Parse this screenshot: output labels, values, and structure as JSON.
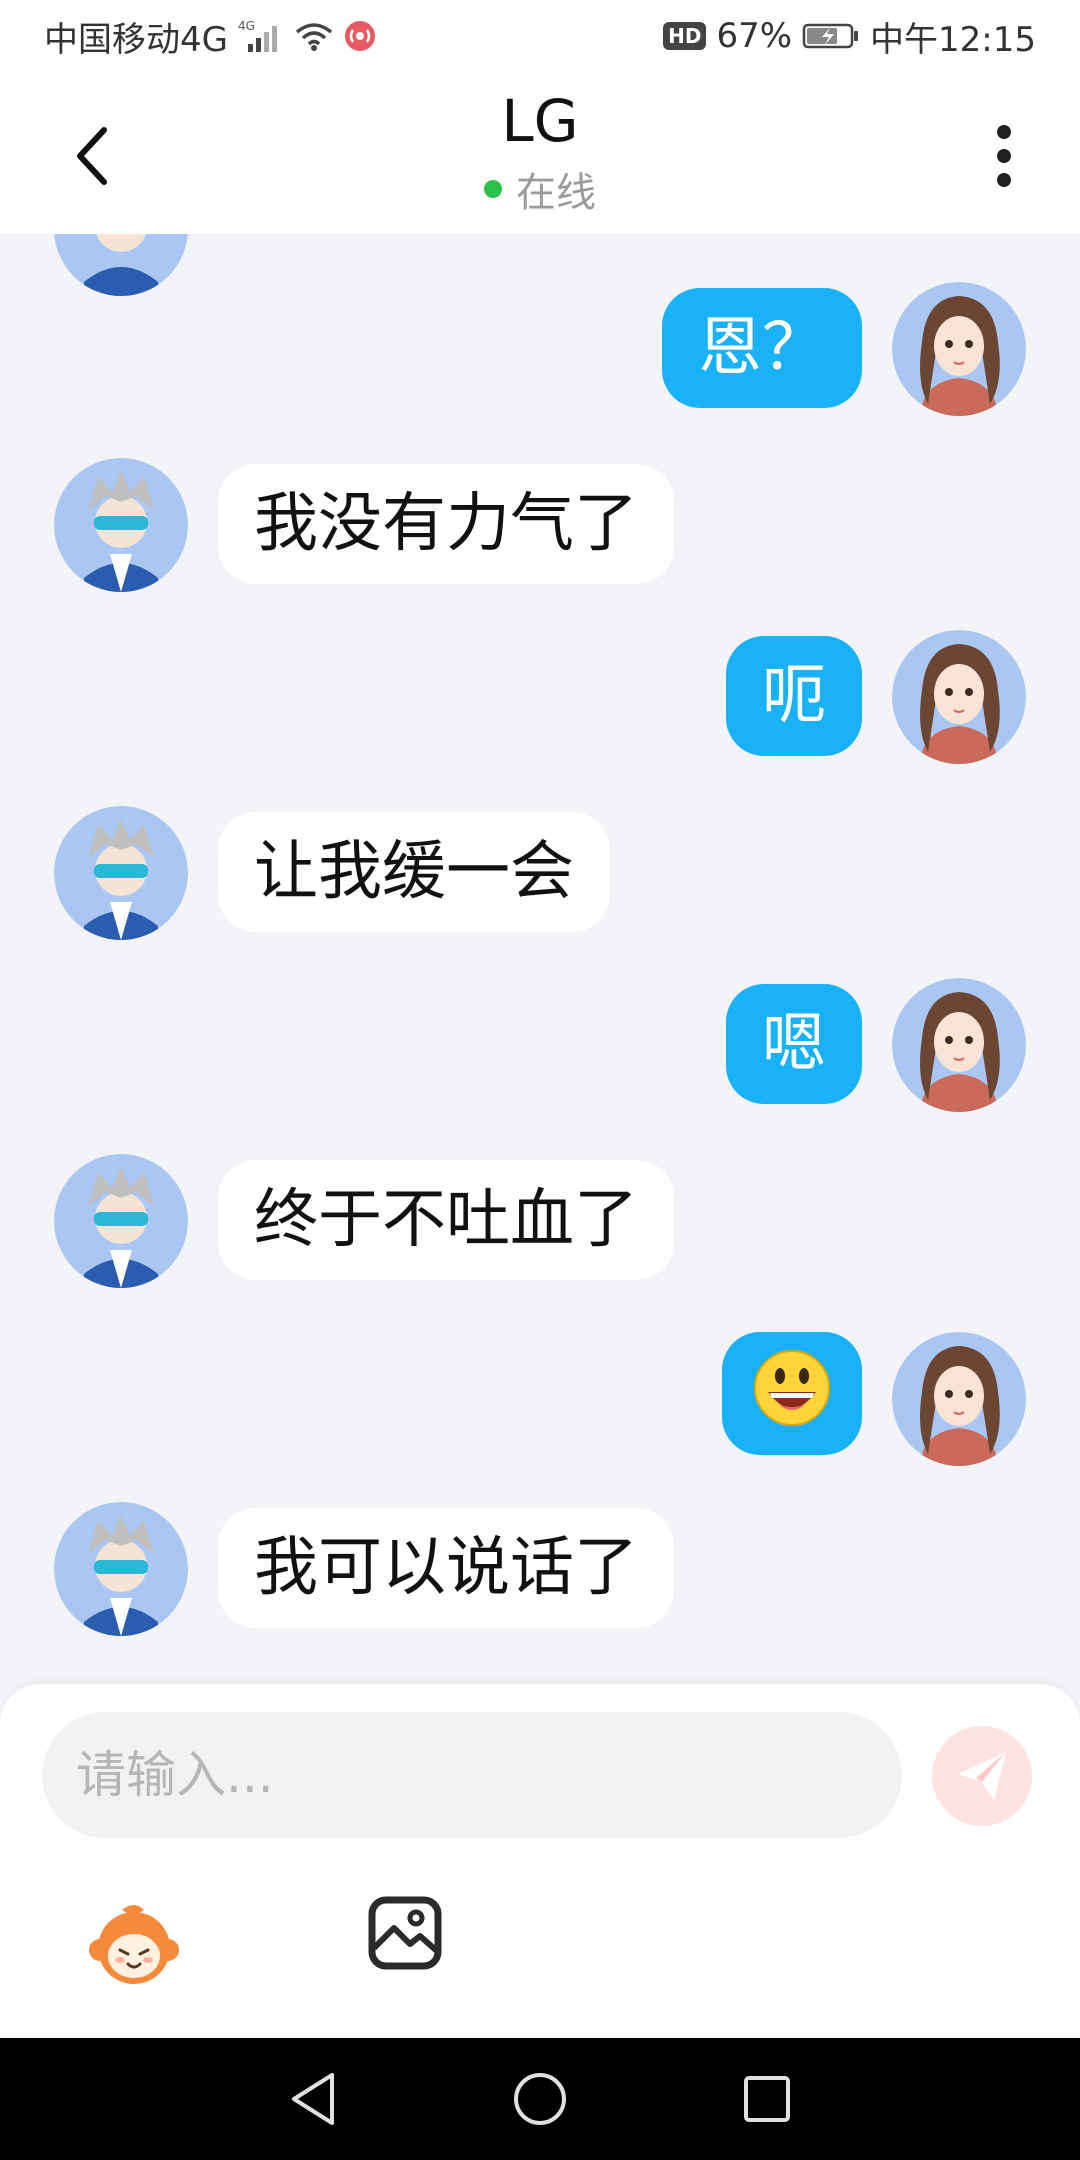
{
  "status_bar": {
    "carrier": "中国移动4G",
    "network_badge": "4G",
    "hd_badge": "HD",
    "battery": "67%",
    "time": "中午12:15"
  },
  "header": {
    "title": "LG",
    "presence": "在线",
    "presence_color": "#2bc24a",
    "back_icon": "chevron-left-icon",
    "more_icon": "more-vertical-icon"
  },
  "messages": [
    {
      "from": "me",
      "text": "恩？"
    },
    {
      "from": "other",
      "text": "我没有力气了"
    },
    {
      "from": "me",
      "text": "呃"
    },
    {
      "from": "other",
      "text": "让我缓一会"
    },
    {
      "from": "me",
      "text": "嗯"
    },
    {
      "from": "other",
      "text": "终于不吐血了"
    },
    {
      "from": "me",
      "text": "😃"
    },
    {
      "from": "other",
      "text": "我可以说话了"
    }
  ],
  "composer": {
    "placeholder": "请输入...",
    "send_icon": "paper-plane-icon",
    "tools": [
      "sticker-icon",
      "image-icon"
    ]
  },
  "colors": {
    "outgoing_bubble": "#19b1f7",
    "incoming_bubble": "#ffffff",
    "background": "#f3f4f7"
  },
  "nav": {
    "icons": [
      "back-triangle-icon",
      "home-circle-icon",
      "recents-square-icon"
    ]
  }
}
